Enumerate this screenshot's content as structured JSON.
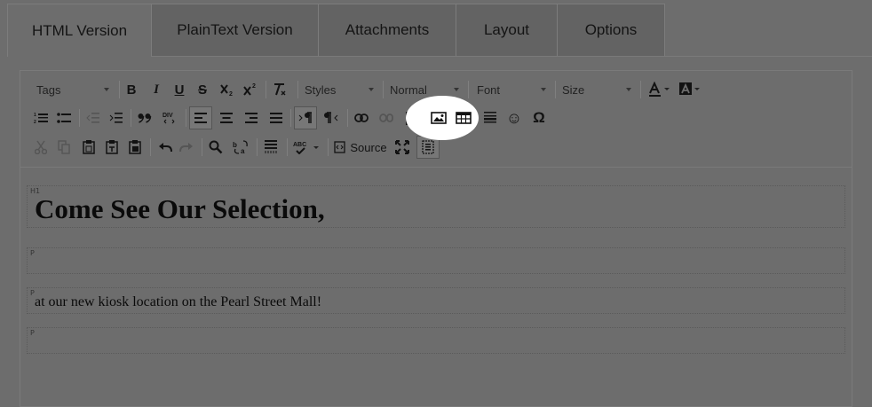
{
  "tabs": [
    "HTML Version",
    "PlainText Version",
    "Attachments",
    "Layout",
    "Options"
  ],
  "toolbar": {
    "tags_label": "Tags",
    "styles_label": "Styles",
    "format_label": "Normal",
    "font_label": "Font",
    "size_label": "Size",
    "source_label": "Source",
    "bold_glyph": "B",
    "italic_glyph": "I",
    "underline_glyph": "U",
    "strike_glyph": "S",
    "omega_glyph": "Ω",
    "smiley_glyph": "☺"
  },
  "content": {
    "h1_tag": "H1",
    "h1_text": "Come See Our Selection,",
    "p_tag": "P",
    "p2_text": "at our new kiosk location on the Pearl Street Mall!"
  },
  "colors": {
    "backdrop": "#6d6d6d",
    "spotlight": "#ffffff"
  }
}
